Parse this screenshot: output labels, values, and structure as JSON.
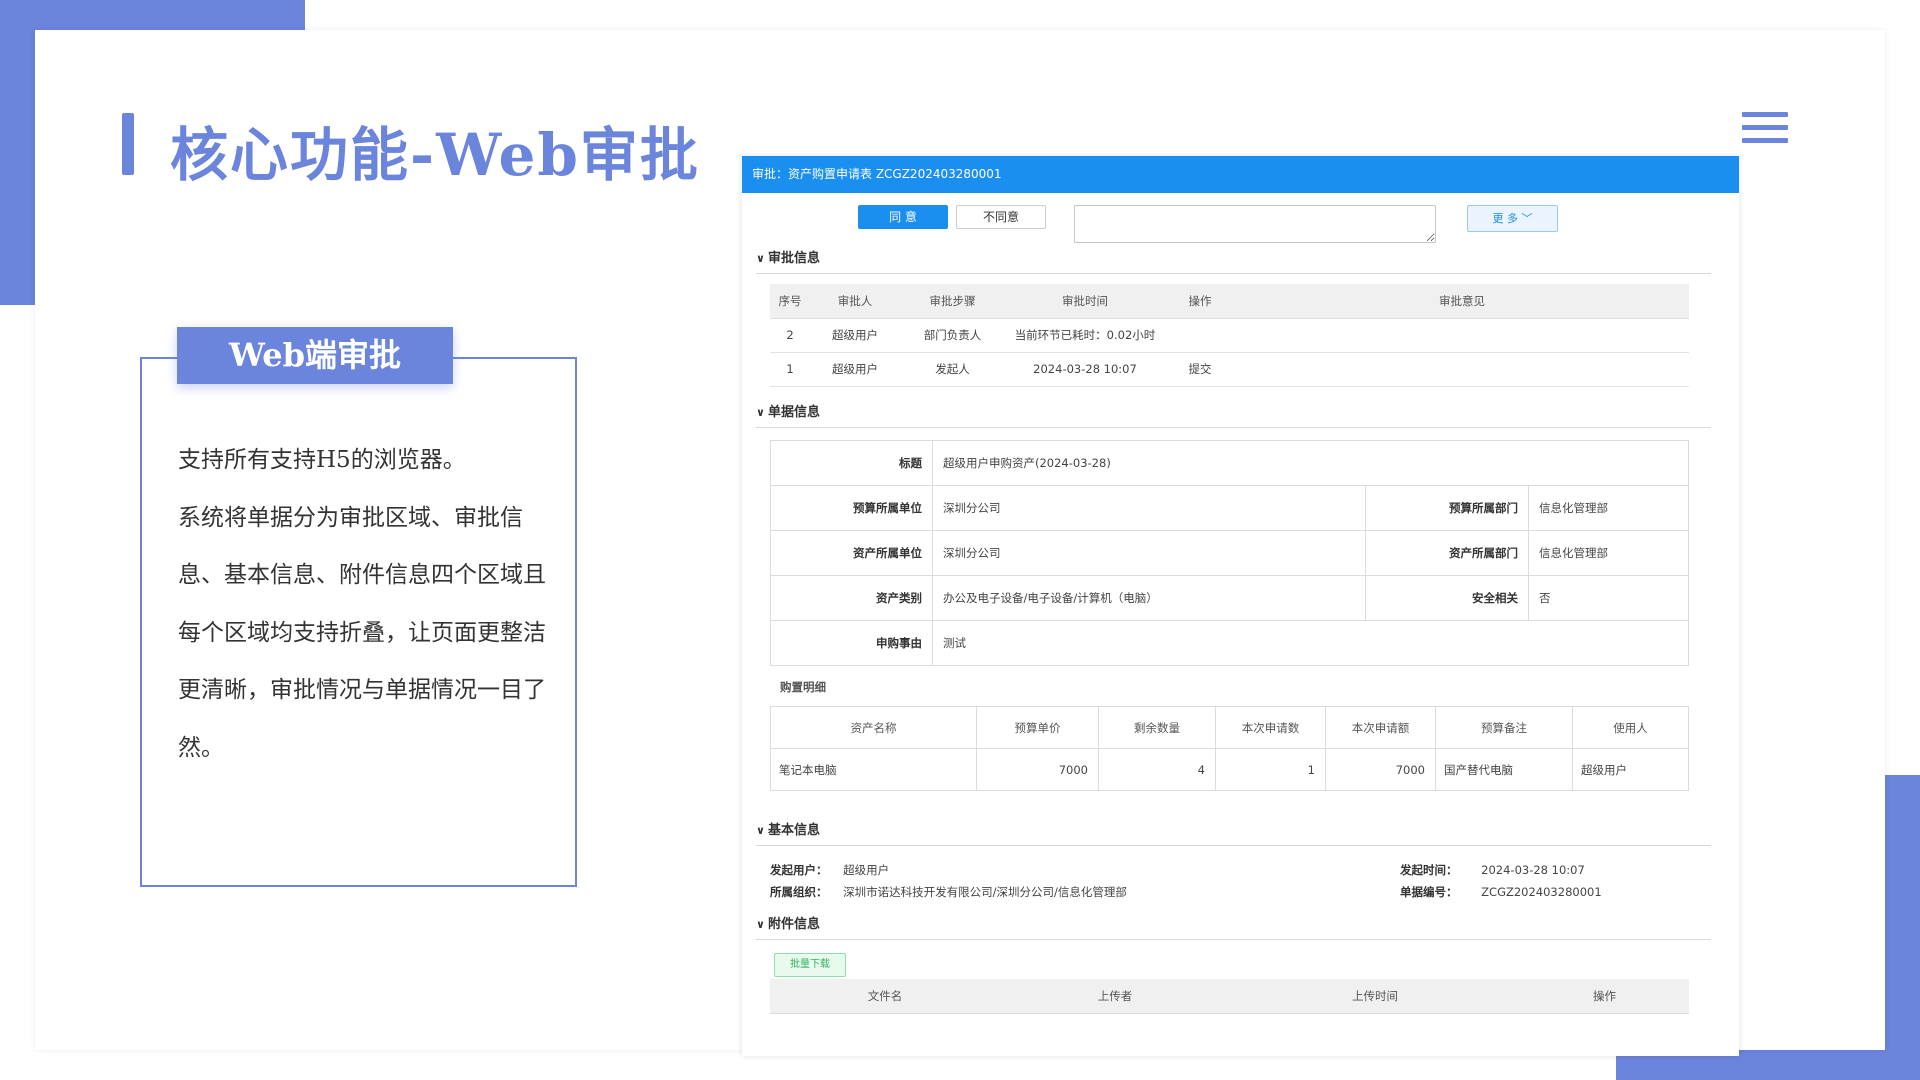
{
  "slide": {
    "title": "核心功能-Web审批",
    "card": {
      "tab_label": "Web端审批",
      "paragraphs": [
        "支持所有支持H5的浏览器。",
        "系统将单据分为审批区域、审批信息、基本信息、附件信息四个区域且每个区域均支持折叠，让页面更整洁更清晰，审批情况与单据情况一目了然。"
      ]
    }
  },
  "icons": {
    "menu": "hamburger-menu-icon",
    "chevron": "chevron-down-icon"
  },
  "colors": {
    "accent": "#6b84dc",
    "panel_header": "#1b8ff0",
    "download_button": "#35b35e"
  },
  "panel": {
    "header": "审批：资产购置申请表 ZCGZ202403280001",
    "toolbar": {
      "agree": "同 意",
      "disagree": "不同意",
      "more": "更 多"
    },
    "sections": {
      "approval_info": "审批信息",
      "document_info": "单据信息",
      "basic_info": "基本信息",
      "attachment_info": "附件信息"
    },
    "approval_table": {
      "headers": [
        "序号",
        "审批人",
        "审批步骤",
        "审批时间",
        "操作",
        "审批意见"
      ],
      "rows": [
        [
          "2",
          "超级用户",
          "部门负责人",
          "当前环节已耗时：0.02小时",
          "",
          ""
        ],
        [
          "1",
          "超级用户",
          "发起人",
          "2024-03-28 10:07",
          "提交",
          ""
        ]
      ]
    },
    "document_form": {
      "title_label": "标题",
      "title_value": "超级用户申购资产(2024-03-28)",
      "budget_unit_label": "预算所属单位",
      "budget_unit_value": "深圳分公司",
      "budget_dept_label": "预算所属部门",
      "budget_dept_value": "信息化管理部",
      "asset_unit_label": "资产所属单位",
      "asset_unit_value": "深圳分公司",
      "asset_dept_label": "资产所属部门",
      "asset_dept_value": "信息化管理部",
      "asset_type_label": "资产类别",
      "asset_type_value": "办公及电子设备/电子设备/计算机（电脑）",
      "security_label": "安全相关",
      "security_value": "否",
      "reason_label": "申购事由",
      "reason_value": "测试"
    },
    "purchase_details": {
      "caption": "购置明细",
      "headers": [
        "资产名称",
        "预算单价",
        "剩余数量",
        "本次申请数",
        "本次申请额",
        "预算备注",
        "使用人"
      ],
      "rows": [
        [
          "笔记本电脑",
          "7000",
          "4",
          "1",
          "7000",
          "国产替代电脑",
          "超级用户"
        ]
      ]
    },
    "basic": {
      "initiator_label": "发起用户：",
      "initiator_value": "超级用户",
      "org_label": "所属组织：",
      "org_value": "深圳市诺达科技开发有限公司/深圳分公司/信息化管理部",
      "time_label": "发起时间：",
      "time_value": "2024-03-28 10:07",
      "number_label": "单据编号：",
      "number_value": "ZCGZ202403280001"
    },
    "attachments": {
      "download_label": "批量下载",
      "headers": [
        "文件名",
        "上传者",
        "上传时间",
        "操作"
      ]
    }
  }
}
